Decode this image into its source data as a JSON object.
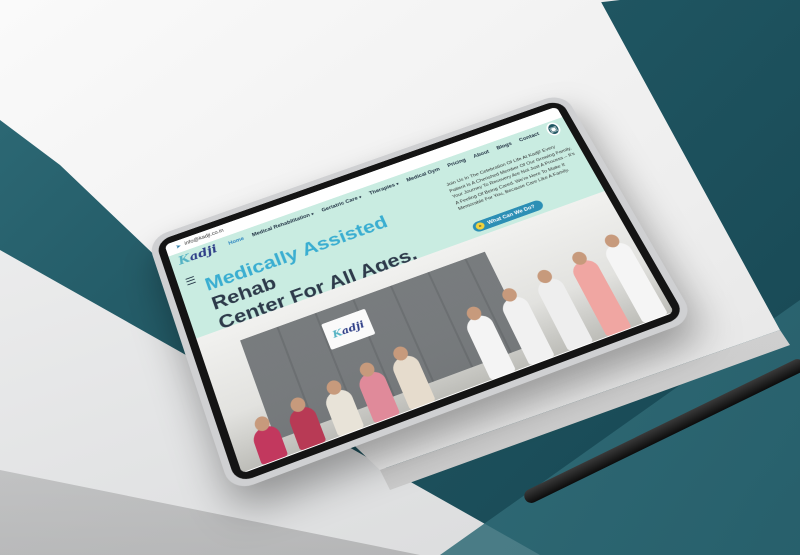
{
  "site": {
    "topbar": {
      "email": "info@kadji.co.in",
      "email_icon": "send-icon"
    },
    "logo": {
      "part1": "K",
      "part2": "adji"
    },
    "nav": {
      "items": [
        {
          "label": "Home",
          "active": true,
          "dropdown": false
        },
        {
          "label": "Medical Rehabilitation",
          "active": false,
          "dropdown": true
        },
        {
          "label": "Geriatric Care",
          "active": false,
          "dropdown": true
        },
        {
          "label": "Therapies",
          "active": false,
          "dropdown": true
        },
        {
          "label": "Medical Gym",
          "active": false,
          "dropdown": false
        },
        {
          "label": "Pricing",
          "active": false,
          "dropdown": false
        },
        {
          "label": "About",
          "active": false,
          "dropdown": false
        },
        {
          "label": "Blogs",
          "active": false,
          "dropdown": false
        },
        {
          "label": "Contact",
          "active": false,
          "dropdown": false
        }
      ],
      "contact_icon": "calendar-icon"
    },
    "hero": {
      "title_accent": "Medically Assisted",
      "title_rest_1": "Rehab",
      "title_rest_2": "Center For All Ages.",
      "text": "Join Us In The Celebration Of Life At Kadji! Every Patient Is A Cherished Member Of Our Growing Family. Your Journey To Recovery Are Not Just A Process – It's A Feeling Of Being Cared. We're Here To Make It Memorable For You, Because Care Like A Family.",
      "cta_label": "What Can We Do?",
      "cta_icon": "double-chevron-right-icon"
    },
    "photo": {
      "sign_part1": "K",
      "sign_part2": "adji"
    }
  },
  "colors": {
    "mint": "#c9ece1",
    "accent_blue": "#3aaed1",
    "dark_text": "#2d3a4a",
    "cta_bg": "#2c8fb5",
    "cta_dot": "#f2d23c",
    "teal_bg": "#1f5561"
  }
}
